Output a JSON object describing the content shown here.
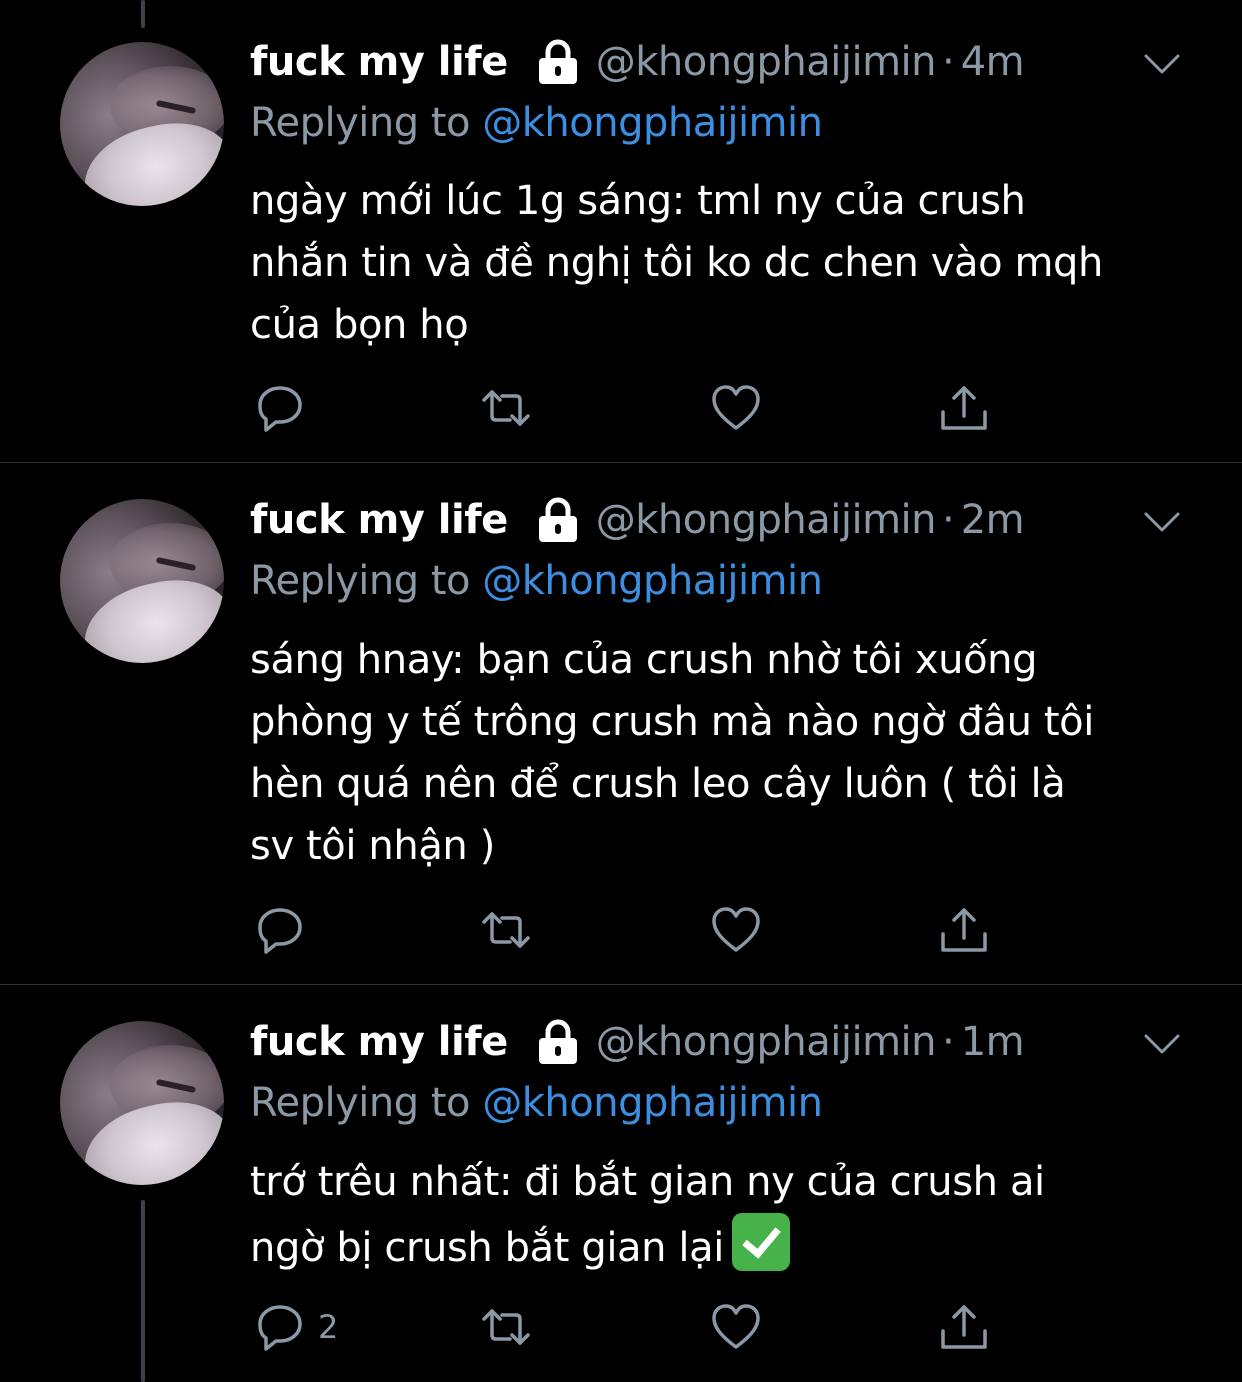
{
  "tweets": [
    {
      "name": "fuck my life",
      "handle": "@khongphaijimin",
      "separator": "·",
      "time": "4m",
      "replying_label": "Replying to",
      "replying_to": "@khongphaijimin",
      "text_lines": [
        "ngày mới lúc 1g sáng: tml ny của crush",
        "nhắn tin và đề nghị tôi ko dc chen vào mqh",
        "của bọn họ"
      ],
      "reply_count": ""
    },
    {
      "name": "fuck my life",
      "handle": "@khongphaijimin",
      "separator": "·",
      "time": "2m",
      "replying_label": "Replying to",
      "replying_to": "@khongphaijimin",
      "text_lines": [
        "sáng hnay: bạn của crush nhờ tôi xuống",
        "phòng y tế trông crush mà nào ngờ đâu tôi",
        "hèn quá nên để crush leo cây luôn ( tôi là",
        "sv tôi nhận )"
      ],
      "reply_count": ""
    },
    {
      "name": "fuck my life",
      "handle": "@khongphaijimin",
      "separator": "·",
      "time": "1m",
      "replying_label": "Replying to",
      "replying_to": "@khongphaijimin",
      "text_lines": [
        "trớ trêu nhất: đi bắt gian ny của crush ai",
        "ngờ bị crush bắt gian lại"
      ],
      "emoji": "check-mark-button",
      "reply_count": "2"
    }
  ],
  "icons": {
    "lock": "lock-icon",
    "menu": "chevron-down-icon",
    "reply": "reply-icon",
    "retweet": "retweet-icon",
    "like": "heart-icon",
    "share": "share-icon"
  },
  "colors": {
    "background": "#000000",
    "text": "#ffffff",
    "secondary": "#8b98a5",
    "link": "#3c8fe0",
    "divider": "#2f3336",
    "thread_line": "#3d4148"
  }
}
